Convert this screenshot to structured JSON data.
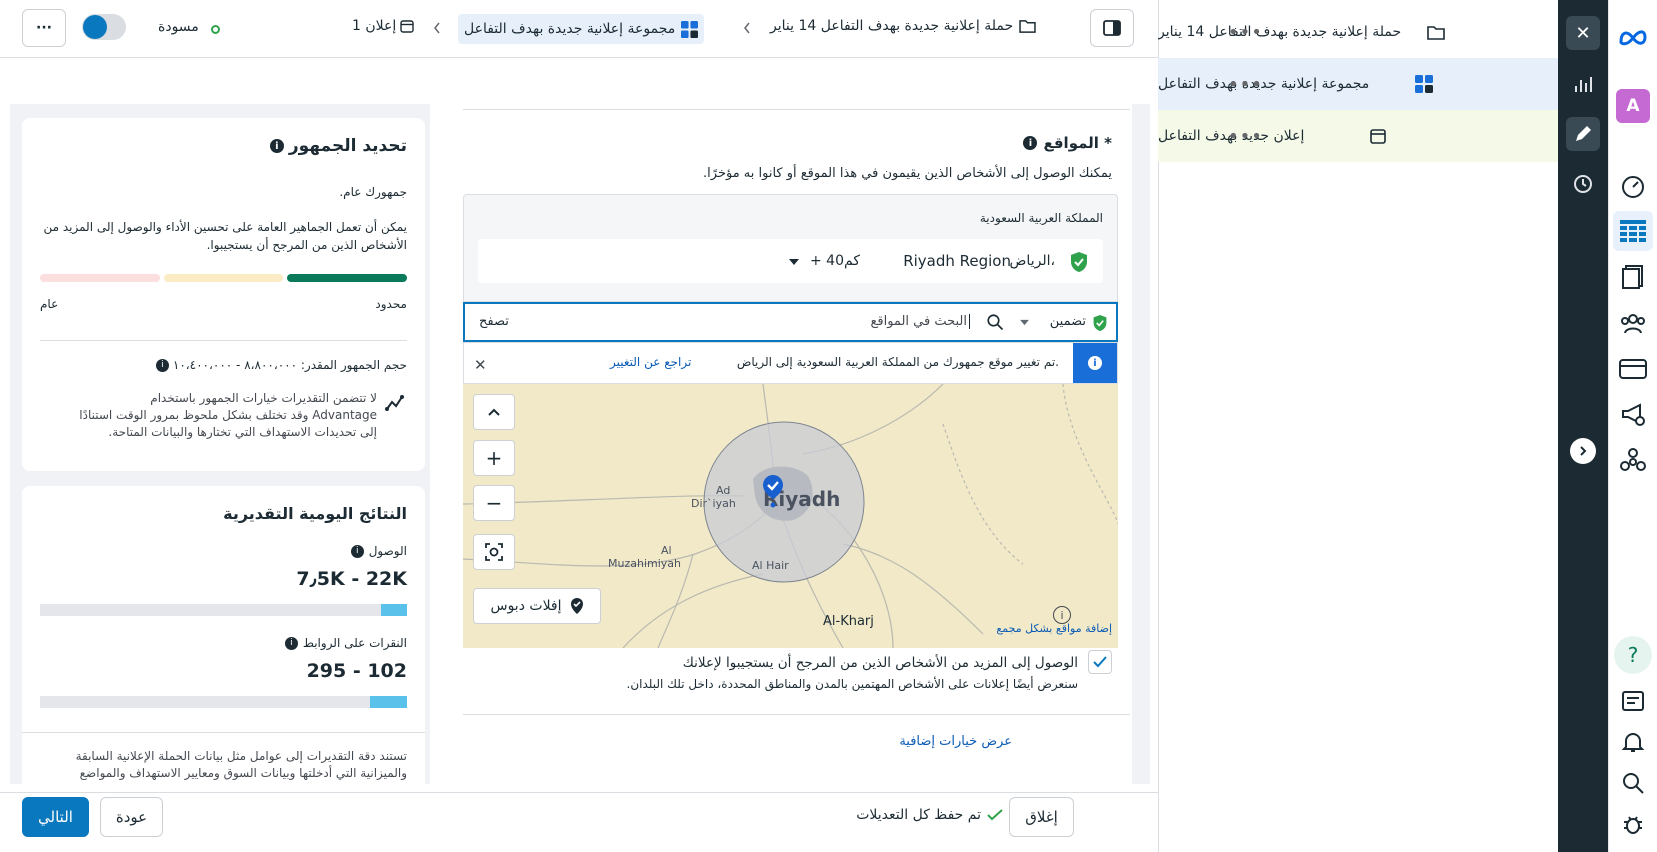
{
  "header": {
    "draft_label": "مسودة",
    "breadcrumb_campaign": "حملة إعلانية جديدة بهدف التفاعل 14 يناير",
    "breadcrumb_adset": "مجموعة إعلانية جديدة بهدف التفاعل",
    "breadcrumb_ad": "1 إعلان",
    "more_label": "···"
  },
  "tree": {
    "campaign": "حملة إعلانية جديدة بهدف التفاعل 14 يناير",
    "adset": "مجموعة إعلانية جديدة بهدف التفاعل",
    "ad": "إعلان جديد بهدف التفاعل",
    "dots": "•••"
  },
  "rail": {
    "avatar_letter": "A",
    "help": "?",
    "close": "✕"
  },
  "audience": {
    "title": "تحديد الجمهور",
    "subtitle": "جمهورك عام.",
    "desc": "يمكن أن تعمل الجماهير العامة على تحسين الأداء والوصول إلى المزيد من الأشخاص الذين من المرجح أن يستجيبوا.",
    "specific": "محدود",
    "broad": "عام",
    "size_label": "حجم الجمهور المقدر: ٨،٨٠٠،٠٠٠ - ١٠،٤٠٠،٠٠٠",
    "note_1": "لا تتضمن التقديرات خيارات الجمهور باستخدام",
    "note_2": "Advantage وقد تختلف بشكل ملحوظ بمرور الوقت استنادًا",
    "note_3": "إلى تحديدات الاستهداف التي تختارها والبيانات المتاحة."
  },
  "results": {
    "title": "النتائج اليومية التقديرية",
    "reach_label": "الوصول",
    "reach_value": "7٫5K - 22K",
    "reach_fill": 0.07,
    "clicks_label": "النقرات على الروابط",
    "clicks_value": "295 - 102",
    "clicks_fill": 0.1,
    "footnote_1": "تستند دقة التقديرات إلى عوامل مثل بيانات الحملة الإعلانية السابقة",
    "footnote_2": "والميزانية التي أدخلتها وبيانات السوق ومعايير الاستهداف والمواضع"
  },
  "locations": {
    "title": "* المواقع",
    "desc": "يمكنك الوصول إلى الأشخاص الذين يقيمون في هذا الموقع أو كانوا به مؤخرًا.",
    "country": "المملكة العربية السعودية",
    "region_city": "الرياض،",
    "region_name": "Riyadh Region",
    "radius": "+ 40كم",
    "include": "تضمين",
    "search_placeholder": "البحث في المواقع",
    "browse": "تصفح",
    "notice": "تم تغيير موقع جمهورك من المملكة العربية السعودية إلى الرياض.",
    "revert": "تراجع عن التغيير",
    "drop_pin": "إفلات دبوس",
    "bulk_add": "إضافة مواقع بشكل مجمع",
    "reach_more": "الوصول إلى المزيد من الأشخاص الذين من المرجح أن يستجيبوا لإعلانك",
    "reach_more_desc": "سنعرض أيضًا إعلانات على الأشخاص المهتمين بالمدن والمناطق المحددة، داخل تلك البلدان.",
    "more_link": "عرض خيارات إضافية"
  },
  "map": {
    "riyadh": "Riyadh",
    "diriyah": "Dir`iyah",
    "ad": "Ad",
    "al": "Al",
    "muzahimiyah": "Muzahimiyah",
    "al_hair": "Al Hair",
    "al_kharj": "Al-Kharj"
  },
  "footer": {
    "close": "إغلاق",
    "saved": "تم حفظ كل التعديلات",
    "back": "عودة",
    "next": "التالي"
  },
  "colors": {
    "accent": "#0a78be",
    "dark_rail": "#1c2b33",
    "green": "#31a24c",
    "map_bg": "#f1e9c8",
    "radius_fill": "#c8ccd6"
  }
}
